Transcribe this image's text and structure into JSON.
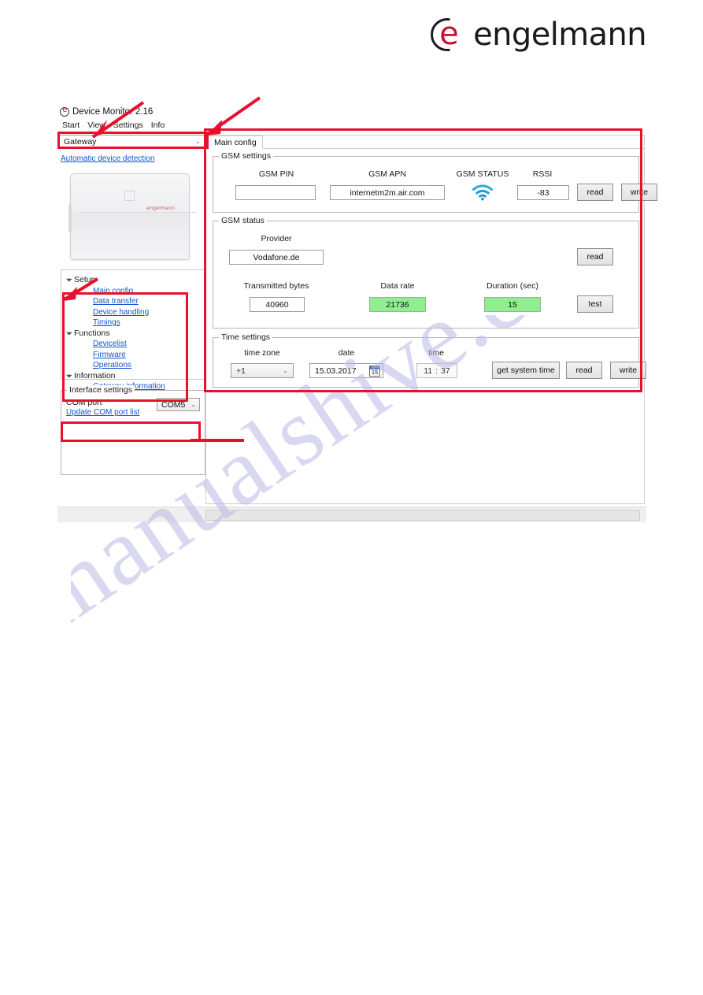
{
  "brand": {
    "logo_text": "engelmann",
    "logo_accent_color": "#c8102e"
  },
  "watermark": {
    "text": "manualshive.com"
  },
  "window": {
    "title": "Device Monitor 2.16",
    "icon": "app-icon",
    "menu": [
      {
        "label": "Start"
      },
      {
        "label": "View"
      },
      {
        "label": "Settings"
      },
      {
        "label": "Info"
      }
    ]
  },
  "left": {
    "device_select": {
      "value": "Gateway",
      "caret": "⌄"
    },
    "auto_detect_link": "Automatic device detection",
    "device_photo": {
      "logo_text": "engelmann"
    },
    "nav": [
      {
        "label": "Setup",
        "arrow": "◢",
        "children": [
          "Main config",
          "Data transfer",
          "Device handling",
          "Timings"
        ]
      },
      {
        "label": "Functions",
        "arrow": "◢",
        "children": [
          "Devicelist",
          "Firmware",
          "Operations"
        ]
      },
      {
        "label": "Information",
        "arrow": "◢",
        "children": [
          "Gateway information"
        ]
      }
    ],
    "interface": {
      "legend": "Interface settings",
      "com_port_label": "COM port",
      "update_link": "Update COM port list",
      "com_value": "COM5",
      "caret": "⌄"
    }
  },
  "main": {
    "tab": "Main config",
    "gsm_settings": {
      "legend": "GSM settings",
      "pin_label": "GSM PIN",
      "pin_value": "",
      "apn_label": "GSM APN",
      "apn_value": "internetm2m.air.com",
      "status_label": "GSM STATUS",
      "status_icon": "wifi-icon",
      "status_icon_color": "#1f9ad6",
      "rssi_label": "RSSI",
      "rssi_value": "-83",
      "read_button": "read",
      "write_button": "write"
    },
    "gsm_status": {
      "legend": "GSM status",
      "provider_label": "Provider",
      "provider_value": "Vodafone.de",
      "read_button": "read",
      "transmitted_label": "Transmitted bytes",
      "transmitted_value": "40960",
      "datarate_label": "Data rate",
      "datarate_value": "21736",
      "duration_label": "Duration (sec)",
      "duration_value": "15",
      "test_button": "test",
      "highlight_color": "#90ee90"
    },
    "time_settings": {
      "legend": "Time settings",
      "timezone_label": "time zone",
      "timezone_value": "+1",
      "caret": "⌄",
      "date_label": "date",
      "date_value": "15.03.2017",
      "calendar_day": "15",
      "time_label": "time",
      "time_hours": "11",
      "time_separator": ":",
      "time_minutes": "37",
      "get_system_time_button": "get system time",
      "read_button": "read",
      "write_button": "write"
    }
  },
  "annotations": {
    "color": "#e8112d"
  }
}
